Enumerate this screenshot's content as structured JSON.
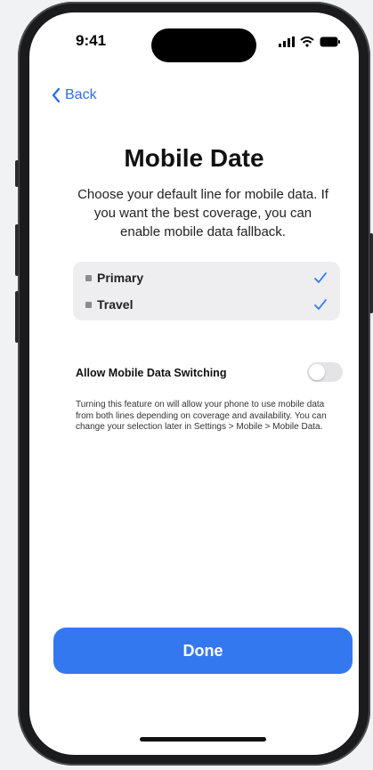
{
  "status_bar": {
    "time": "9:41"
  },
  "nav": {
    "back_label": "Back"
  },
  "page": {
    "title": "Mobile Date",
    "subtitle": "Choose your default line for mobile data. If you want the best coverage, you can enable mobile data fallback."
  },
  "lines": [
    {
      "label": "Primary",
      "checked": true
    },
    {
      "label": "Travel",
      "checked": true
    }
  ],
  "data_switching": {
    "label": "Allow Mobile Data Switching",
    "enabled": false,
    "description": "Turning this feature on will allow your phone to use mobile data from both lines depending on coverage and availability. You can change your selection later in Settings > Mobile > Mobile Data."
  },
  "footer": {
    "done_label": "Done"
  },
  "colors": {
    "accent": "#3478f0",
    "background": "#f1f2f3",
    "list_bg": "#eeeef0"
  }
}
